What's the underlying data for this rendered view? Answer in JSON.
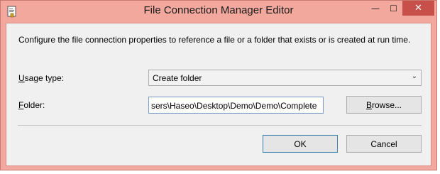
{
  "window": {
    "title": "File Connection Manager Editor",
    "min_glyph": "—",
    "max_glyph": "☐",
    "close_glyph": "✕"
  },
  "form": {
    "description": "Configure the file connection properties to reference a file or a folder that exists or is created at run time.",
    "usage_type": {
      "label_accel": "U",
      "label_rest": "sage type:",
      "value": "Create folder",
      "chevron": "⌄"
    },
    "folder": {
      "label_accel": "F",
      "label_rest": "older:",
      "value": "sers\\Haseo\\Desktop\\Demo\\Demo\\Complete"
    },
    "browse_accel": "B",
    "browse_rest": "rowse..."
  },
  "buttons": {
    "ok": "OK",
    "cancel": "Cancel"
  },
  "colors": {
    "titlebar": "#f2a89d",
    "close": "#c7504a",
    "client": "#f0f0f0"
  },
  "icons": {
    "app": "document-connection-icon"
  }
}
